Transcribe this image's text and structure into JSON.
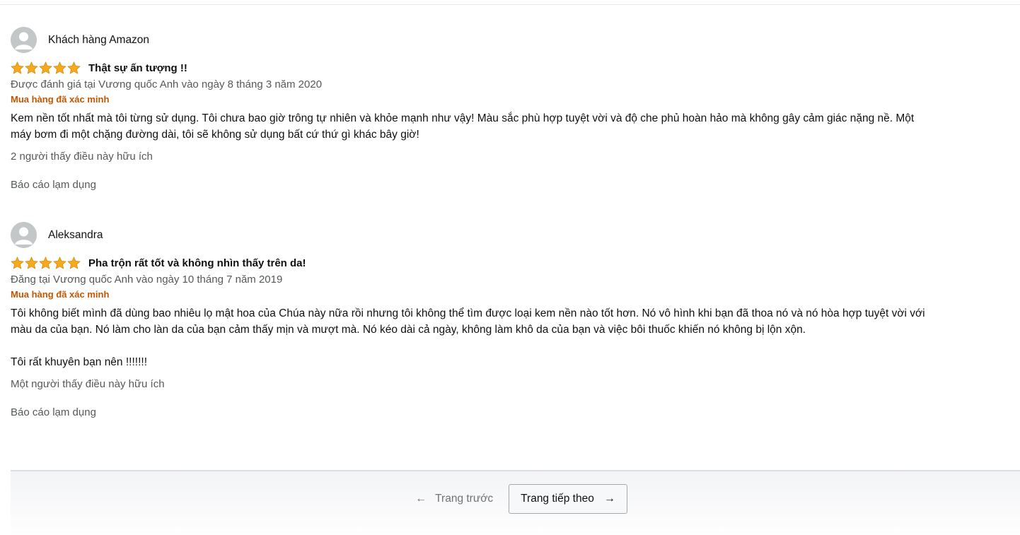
{
  "reviews": [
    {
      "author": "Khách hàng Amazon",
      "rating": 5,
      "title": "Thật sự ấn tượng !!",
      "date": "Được đánh giá tại Vương quốc Anh vào ngày 8 tháng 3 năm 2020",
      "verified": "Mua hàng đã xác minh",
      "body": [
        "Kem nền tốt nhất mà tôi từng sử dụng. Tôi chưa bao giờ trông tự nhiên và khỏe mạnh như vậy! Màu sắc phù hợp tuyệt vời và độ che phủ hoàn hảo mà không gây cảm giác nặng nề. Một máy bơm đi một chặng đường dài, tôi sẽ không sử dụng bất cứ thứ gì khác bây giờ!"
      ],
      "helpful": "2 người thấy điều này hữu ích",
      "report": "Báo cáo lạm dụng"
    },
    {
      "author": "Aleksandra",
      "rating": 5,
      "title": "Pha trộn rất tốt và không nhìn thấy trên da!",
      "date": "Đăng tại Vương quốc Anh vào ngày 10 tháng 7 năm 2019",
      "verified": "Mua hàng đã xác minh",
      "body": [
        "Tôi không biết mình đã dùng bao nhiêu lọ mật hoa của Chúa này nữa rồi nhưng tôi không thể tìm được loại kem nền nào tốt hơn. Nó vô hình khi bạn đã thoa nó và nó hòa hợp tuyệt vời với màu da của bạn. Nó làm cho làn da của bạn cảm thấy mịn và mượt mà. Nó kéo dài cả ngày, không làm khô da của bạn và việc bôi thuốc khiến nó không bị lộn xộn.",
        "Tôi rất khuyên bạn nên !!!!!!!"
      ],
      "helpful": "Một người thấy điều này hữu ích",
      "report": "Báo cáo lạm dụng"
    }
  ],
  "pagination": {
    "prev_arrow": "←",
    "prev_label": "Trang trước",
    "next_label": "Trang tiếp theo",
    "next_arrow": "→"
  },
  "colors": {
    "star": "#f7a81b",
    "verified": "#c45500",
    "muted": "#565959"
  },
  "icons": {
    "avatar": "default-user-avatar-icon",
    "star": "star-filled-icon"
  }
}
